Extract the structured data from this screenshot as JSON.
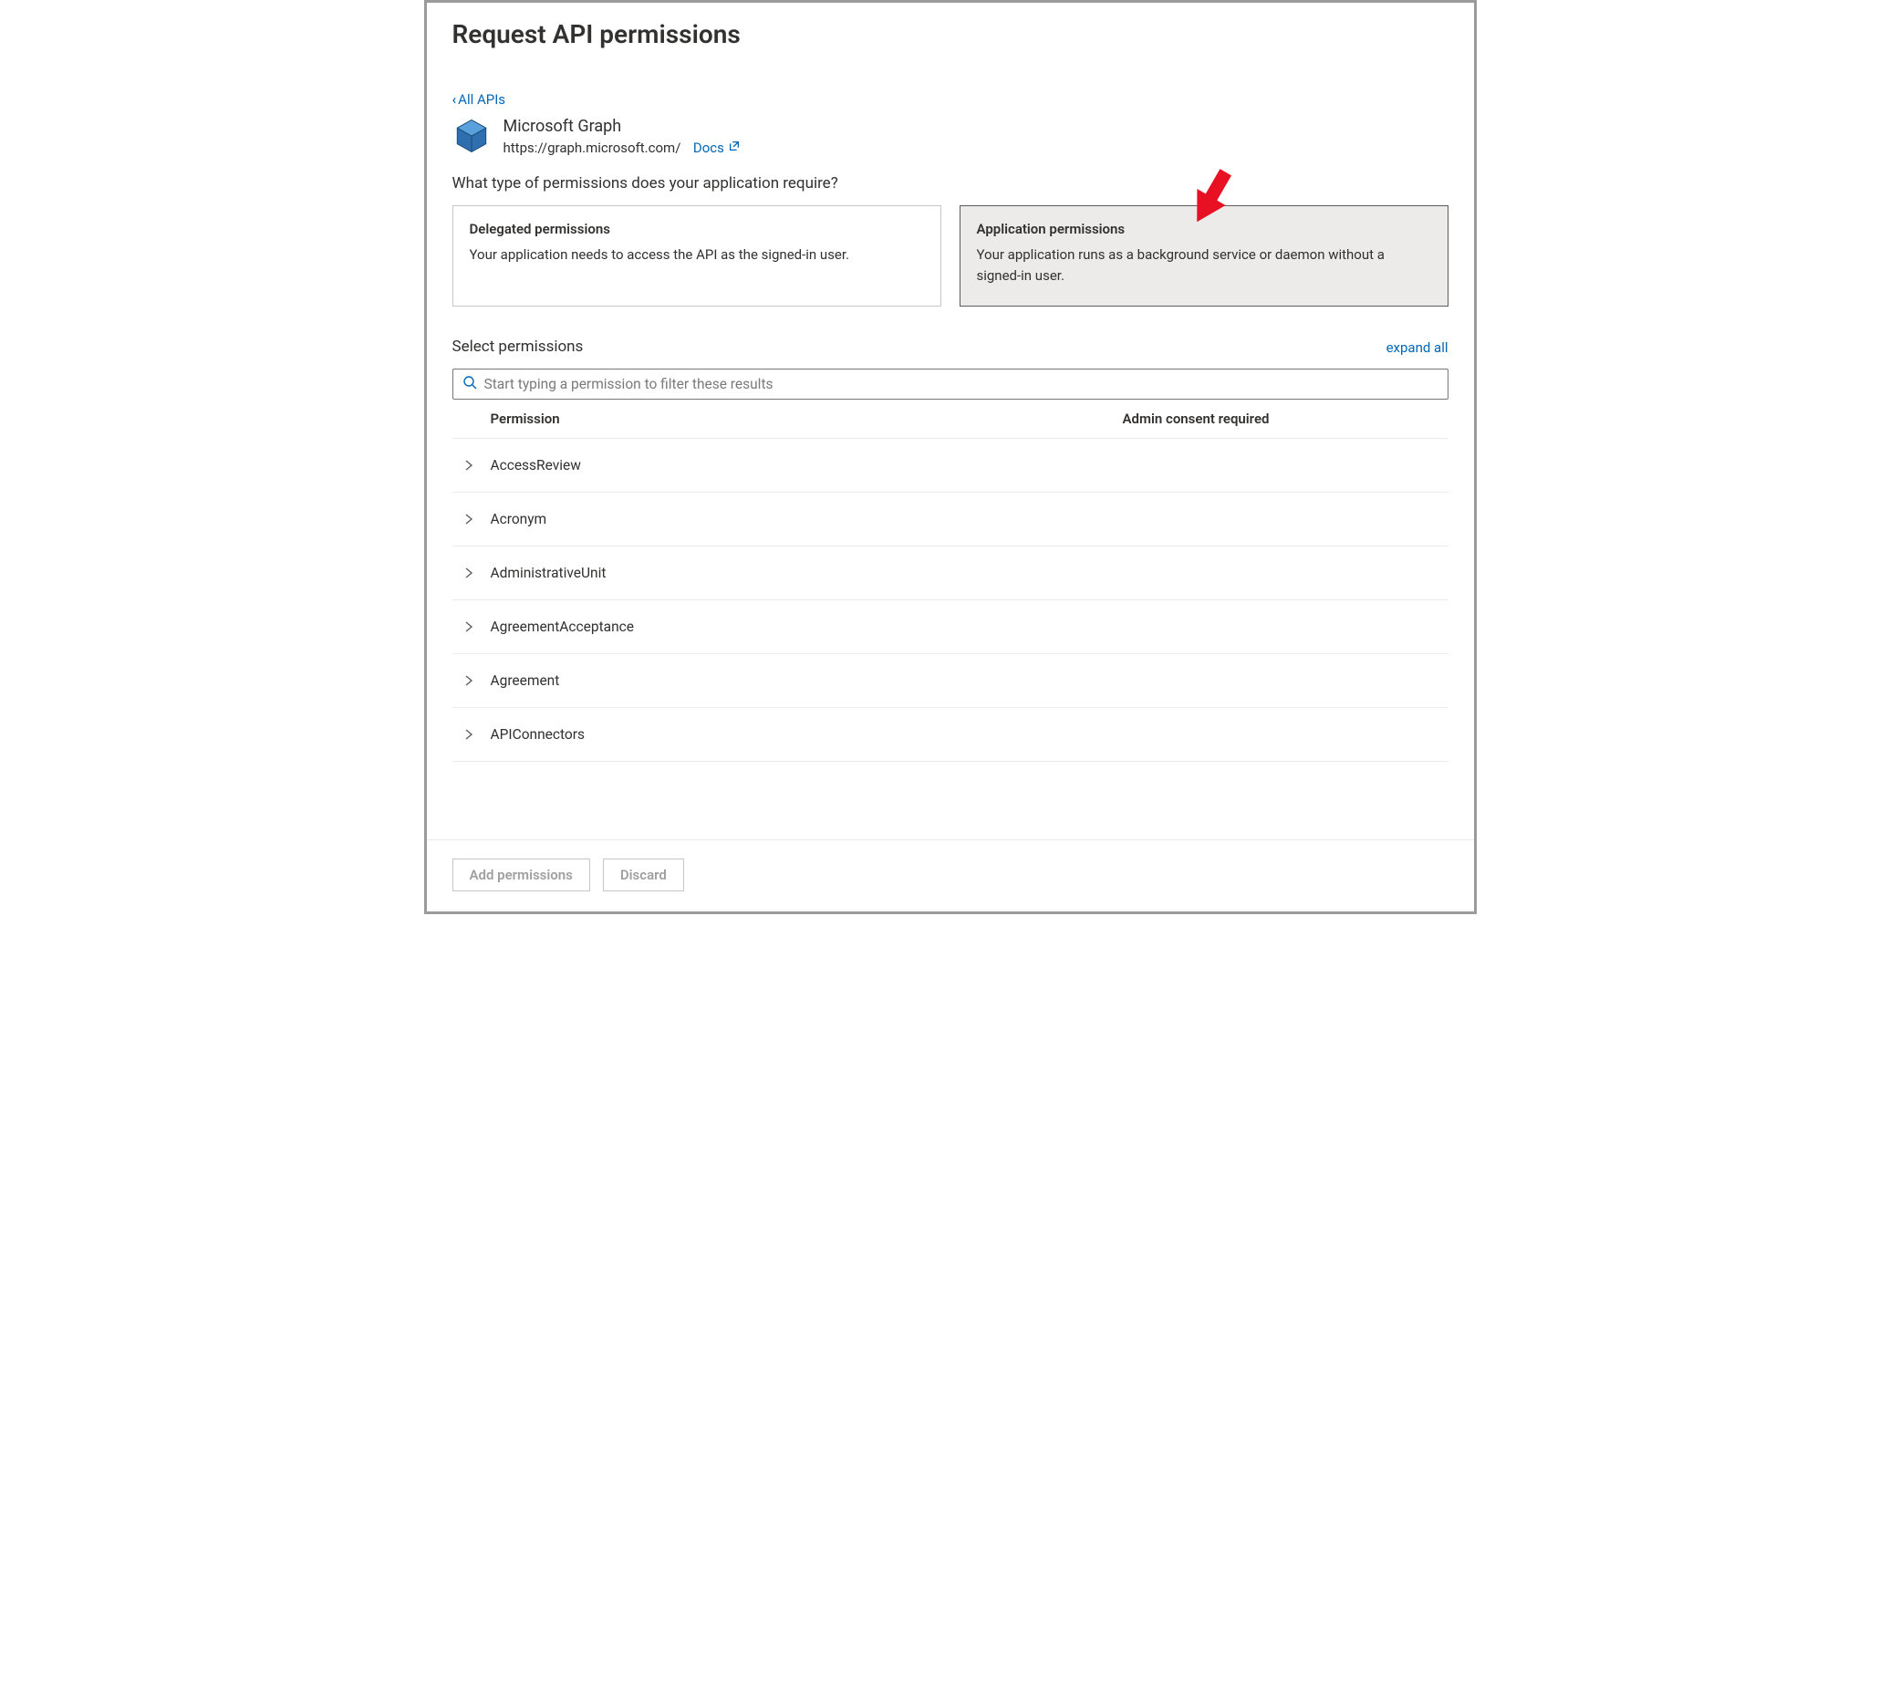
{
  "header": {
    "title": "Request API permissions"
  },
  "back_link": "All APIs",
  "api": {
    "name": "Microsoft Graph",
    "url": "https://graph.microsoft.com/",
    "docs_label": "Docs"
  },
  "question": "What type of permissions does your application require?",
  "cards": {
    "delegated": {
      "title": "Delegated permissions",
      "desc": "Your application needs to access the API as the signed-in user."
    },
    "application": {
      "title": "Application permissions",
      "desc": "Your application runs as a background service or daemon without a signed-in user."
    }
  },
  "section": {
    "title": "Select permissions",
    "expand_label": "expand all"
  },
  "search": {
    "placeholder": "Start typing a permission to filter these results"
  },
  "columns": {
    "permission": "Permission",
    "admin": "Admin consent required"
  },
  "permissions": [
    {
      "name": "AccessReview"
    },
    {
      "name": "Acronym"
    },
    {
      "name": "AdministrativeUnit"
    },
    {
      "name": "AgreementAcceptance"
    },
    {
      "name": "Agreement"
    },
    {
      "name": "APIConnectors"
    }
  ],
  "footer": {
    "add": "Add permissions",
    "discard": "Discard"
  }
}
